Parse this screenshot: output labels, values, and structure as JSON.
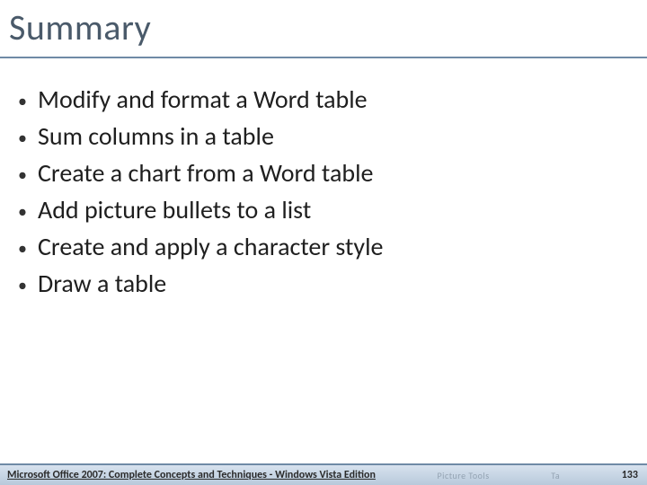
{
  "slide": {
    "title": "Summary",
    "bullets": [
      "Modify and format a Word table",
      "Sum columns in a table",
      "Create a chart from a Word table",
      "Add picture bullets to a list",
      "Create and apply a character style",
      "Draw a table"
    ],
    "footer": {
      "left": "Microsoft Office 2007: Complete Concepts and Techniques - Windows Vista Edition",
      "ghost1": "Picture Tools",
      "ghost2": "Ta",
      "page": "133"
    }
  }
}
